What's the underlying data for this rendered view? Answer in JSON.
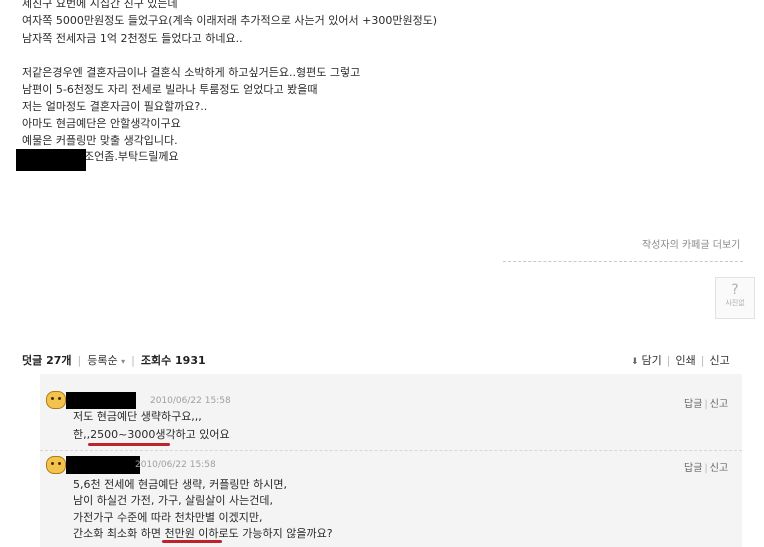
{
  "post": {
    "lines": [
      "제친구 요번에 시집간 친구 있는데",
      "여자쪽 5000만원정도 들었구요(계속 이래저래 추가적으로 사는거 있어서 +300만원정도)",
      "남자쪽 전세자금 1억 2천정도 들었다고 하네요..",
      "",
      "저같은경우엔 결혼자금이나 결혼식 소박하게 하고싶거든요..형편도 그렇고",
      "남편이 5-6천정도 자리 전세로 빌라나 투룸정도 얻었다고 봤을때",
      "저는 얼마정도 결혼자금이 필요할까요?..",
      "아마도 현금예단은 안할생각이구요",
      "예물은 커플링만 맞출 생각입니다.",
      "조언좀.부탁드릴께요"
    ]
  },
  "more_link": "작성자의 카페글 더보기",
  "question_box": {
    "label": "사진없"
  },
  "comment_bar": {
    "count_label": "덧글 27개",
    "sort_label": "등록순",
    "views_label": "조회수 1931",
    "save_label": "담기",
    "print_label": "인쇄",
    "report_label": "신고"
  },
  "comments": [
    {
      "date": "2010/06/22 15:58",
      "reply_label": "답글",
      "report_label": "신고",
      "lines": [
        "저도 현금예단 생략하구요,,,",
        "한,,2500~3000생각하고 있어요"
      ]
    },
    {
      "date": "2010/06/22 15:58",
      "reply_label": "답글",
      "report_label": "신고",
      "lines": [
        "5,6천 전세에 현금예단 생략, 커플링만 하시면,",
        "남이 하실건 가전, 가구, 살림살이 사는건데,",
        "가전가구 수준에 따라 천차만별 이겠지만,",
        "간소화 최소화 하면 천만원 이하로도 가능하지 않을까요?"
      ]
    }
  ],
  "colors": {
    "accent_underline": "#c0222b",
    "comment_bg": "#f4f4f4",
    "avatar": "#f3c44d"
  }
}
